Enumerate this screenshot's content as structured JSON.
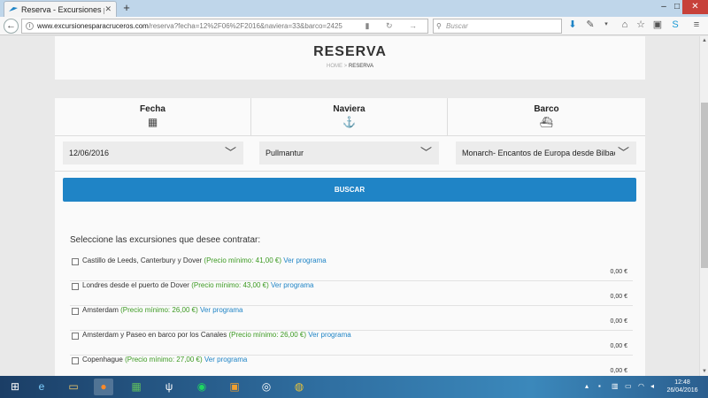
{
  "browser": {
    "tab_title": "Reserva - Excursiones para...",
    "tab_close": "✕",
    "new_tab": "+",
    "url_domain": "www.excursionesparacruceros.com",
    "url_path": "/reserva?fecha=12%2F06%2F2016&naviera=33&barco=2425",
    "search_placeholder": "Buscar",
    "window_min": "–",
    "window_max": "□",
    "window_close": "✕"
  },
  "page": {
    "title": "RESERVA",
    "breadcrumb_home": "HOME",
    "breadcrumb_sep": ">",
    "breadcrumb_current": "RESERVA"
  },
  "form": {
    "fecha_label": "Fecha",
    "naviera_label": "Naviera",
    "barco_label": "Barco",
    "fecha_value": "12/06/2016",
    "naviera_value": "Pullmantur",
    "barco_value": "Monarch- Encantos de Europa desde Bilbao",
    "search_button": "BUSCAR"
  },
  "excursions": {
    "intro": "Seleccione las excursiones que desee contratar:",
    "items": [
      {
        "name": "Castillo de Leeds, Canterbury y Dover",
        "price": "(Precio mínimo: 41,00 €)",
        "link": "Ver programa",
        "amount": "0,00 €"
      },
      {
        "name": "Londres desde el puerto de Dover",
        "price": "(Precio mínimo: 43,00 €)",
        "link": "Ver programa",
        "amount": "0,00 €"
      },
      {
        "name": "Amsterdam",
        "price": "(Precio mínimo: 26,00 €)",
        "link": "Ver programa",
        "amount": "0,00 €"
      },
      {
        "name": "Amsterdam y Paseo en barco por los Canales",
        "price": "(Precio mínimo: 26,00 €)",
        "link": "Ver programa",
        "amount": "0,00 €"
      },
      {
        "name": "Copenhague",
        "price": "(Precio mínimo: 27,00 €)",
        "link": "Ver programa",
        "amount": "0,00 €"
      }
    ]
  },
  "taskbar": {
    "time": "12:48",
    "date": "26/04/2016"
  },
  "colors": {
    "accent": "#1f84c6",
    "price_green": "#3c9a22"
  }
}
